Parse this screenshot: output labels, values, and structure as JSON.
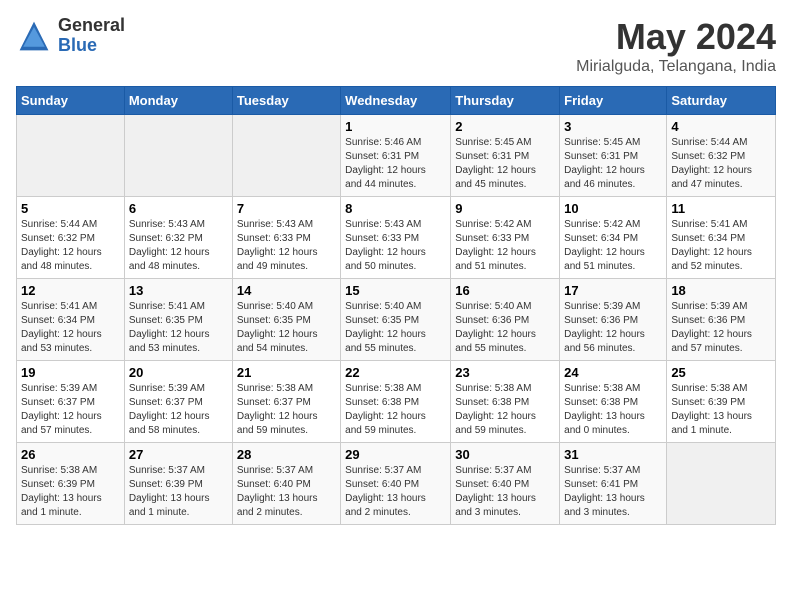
{
  "logo": {
    "general": "General",
    "blue": "Blue"
  },
  "title": {
    "month": "May 2024",
    "location": "Mirialguda, Telangana, India"
  },
  "days_header": [
    "Sunday",
    "Monday",
    "Tuesday",
    "Wednesday",
    "Thursday",
    "Friday",
    "Saturday"
  ],
  "weeks": [
    [
      {
        "num": "",
        "info": ""
      },
      {
        "num": "",
        "info": ""
      },
      {
        "num": "",
        "info": ""
      },
      {
        "num": "1",
        "info": "Sunrise: 5:46 AM\nSunset: 6:31 PM\nDaylight: 12 hours\nand 44 minutes."
      },
      {
        "num": "2",
        "info": "Sunrise: 5:45 AM\nSunset: 6:31 PM\nDaylight: 12 hours\nand 45 minutes."
      },
      {
        "num": "3",
        "info": "Sunrise: 5:45 AM\nSunset: 6:31 PM\nDaylight: 12 hours\nand 46 minutes."
      },
      {
        "num": "4",
        "info": "Sunrise: 5:44 AM\nSunset: 6:32 PM\nDaylight: 12 hours\nand 47 minutes."
      }
    ],
    [
      {
        "num": "5",
        "info": "Sunrise: 5:44 AM\nSunset: 6:32 PM\nDaylight: 12 hours\nand 48 minutes."
      },
      {
        "num": "6",
        "info": "Sunrise: 5:43 AM\nSunset: 6:32 PM\nDaylight: 12 hours\nand 48 minutes."
      },
      {
        "num": "7",
        "info": "Sunrise: 5:43 AM\nSunset: 6:33 PM\nDaylight: 12 hours\nand 49 minutes."
      },
      {
        "num": "8",
        "info": "Sunrise: 5:43 AM\nSunset: 6:33 PM\nDaylight: 12 hours\nand 50 minutes."
      },
      {
        "num": "9",
        "info": "Sunrise: 5:42 AM\nSunset: 6:33 PM\nDaylight: 12 hours\nand 51 minutes."
      },
      {
        "num": "10",
        "info": "Sunrise: 5:42 AM\nSunset: 6:34 PM\nDaylight: 12 hours\nand 51 minutes."
      },
      {
        "num": "11",
        "info": "Sunrise: 5:41 AM\nSunset: 6:34 PM\nDaylight: 12 hours\nand 52 minutes."
      }
    ],
    [
      {
        "num": "12",
        "info": "Sunrise: 5:41 AM\nSunset: 6:34 PM\nDaylight: 12 hours\nand 53 minutes."
      },
      {
        "num": "13",
        "info": "Sunrise: 5:41 AM\nSunset: 6:35 PM\nDaylight: 12 hours\nand 53 minutes."
      },
      {
        "num": "14",
        "info": "Sunrise: 5:40 AM\nSunset: 6:35 PM\nDaylight: 12 hours\nand 54 minutes."
      },
      {
        "num": "15",
        "info": "Sunrise: 5:40 AM\nSunset: 6:35 PM\nDaylight: 12 hours\nand 55 minutes."
      },
      {
        "num": "16",
        "info": "Sunrise: 5:40 AM\nSunset: 6:36 PM\nDaylight: 12 hours\nand 55 minutes."
      },
      {
        "num": "17",
        "info": "Sunrise: 5:39 AM\nSunset: 6:36 PM\nDaylight: 12 hours\nand 56 minutes."
      },
      {
        "num": "18",
        "info": "Sunrise: 5:39 AM\nSunset: 6:36 PM\nDaylight: 12 hours\nand 57 minutes."
      }
    ],
    [
      {
        "num": "19",
        "info": "Sunrise: 5:39 AM\nSunset: 6:37 PM\nDaylight: 12 hours\nand 57 minutes."
      },
      {
        "num": "20",
        "info": "Sunrise: 5:39 AM\nSunset: 6:37 PM\nDaylight: 12 hours\nand 58 minutes."
      },
      {
        "num": "21",
        "info": "Sunrise: 5:38 AM\nSunset: 6:37 PM\nDaylight: 12 hours\nand 59 minutes."
      },
      {
        "num": "22",
        "info": "Sunrise: 5:38 AM\nSunset: 6:38 PM\nDaylight: 12 hours\nand 59 minutes."
      },
      {
        "num": "23",
        "info": "Sunrise: 5:38 AM\nSunset: 6:38 PM\nDaylight: 12 hours\nand 59 minutes."
      },
      {
        "num": "24",
        "info": "Sunrise: 5:38 AM\nSunset: 6:38 PM\nDaylight: 13 hours\nand 0 minutes."
      },
      {
        "num": "25",
        "info": "Sunrise: 5:38 AM\nSunset: 6:39 PM\nDaylight: 13 hours\nand 1 minute."
      }
    ],
    [
      {
        "num": "26",
        "info": "Sunrise: 5:38 AM\nSunset: 6:39 PM\nDaylight: 13 hours\nand 1 minute."
      },
      {
        "num": "27",
        "info": "Sunrise: 5:37 AM\nSunset: 6:39 PM\nDaylight: 13 hours\nand 1 minute."
      },
      {
        "num": "28",
        "info": "Sunrise: 5:37 AM\nSunset: 6:40 PM\nDaylight: 13 hours\nand 2 minutes."
      },
      {
        "num": "29",
        "info": "Sunrise: 5:37 AM\nSunset: 6:40 PM\nDaylight: 13 hours\nand 2 minutes."
      },
      {
        "num": "30",
        "info": "Sunrise: 5:37 AM\nSunset: 6:40 PM\nDaylight: 13 hours\nand 3 minutes."
      },
      {
        "num": "31",
        "info": "Sunrise: 5:37 AM\nSunset: 6:41 PM\nDaylight: 13 hours\nand 3 minutes."
      },
      {
        "num": "",
        "info": ""
      }
    ]
  ]
}
